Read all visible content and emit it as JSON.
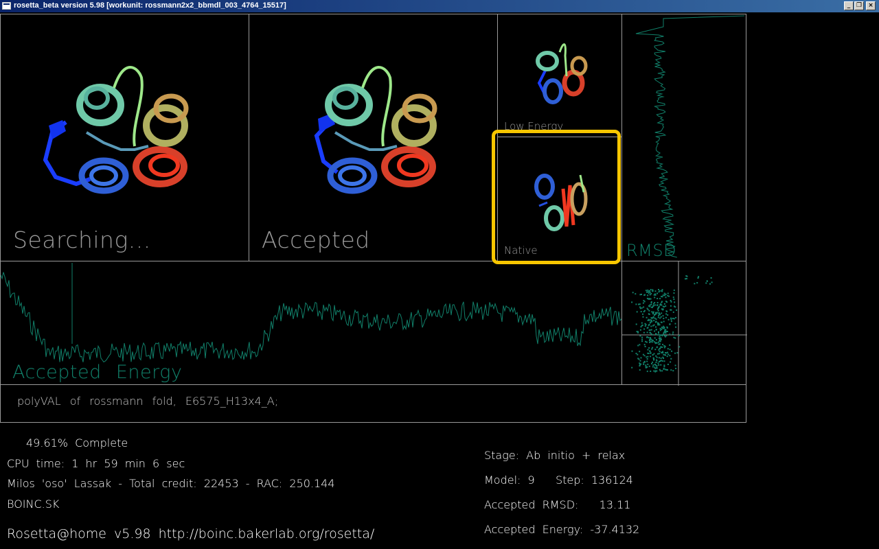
{
  "window": {
    "title": "rosetta_beta version 5.98 [workunit: rossmann2x2_bbmdl_003_4764_15517]",
    "minimize_glyph": "_",
    "restore_glyph": "❐",
    "close_glyph": "×"
  },
  "panels": {
    "searching_label": "Searching...",
    "accepted_label": "Accepted",
    "low_energy_label": "Low Energy",
    "native_label": "Native",
    "rmsd_label": "RMSD",
    "accepted_energy_label": "Accepted Energy",
    "description": "polyVAL of rossmann fold, E6575_H13x4_A;"
  },
  "status": {
    "percent_complete": "49.61% Complete",
    "cpu_time": "CPU time: 1 hr 59 min 6 sec",
    "user_credit": "Milos 'oso' Lassak - Total credit: 22453 - RAC: 250.144",
    "team": "BOINC.SK",
    "footer": "Rosetta@home v5.98 http://boinc.bakerlab.org/rosetta/",
    "stage": "Stage: Ab initio + relax",
    "model_step": "Model: 9   Step: 136124",
    "accepted_rmsd": "Accepted RMSD:   13.11",
    "accepted_energy": "Accepted Energy: -37.4132"
  },
  "colors": {
    "plot_teal": "#11806a",
    "highlight": "#f7c600",
    "frame": "#9a9a9a"
  },
  "icons": {
    "app": "window-app-icon",
    "protein": "protein-ribbon-icon"
  }
}
